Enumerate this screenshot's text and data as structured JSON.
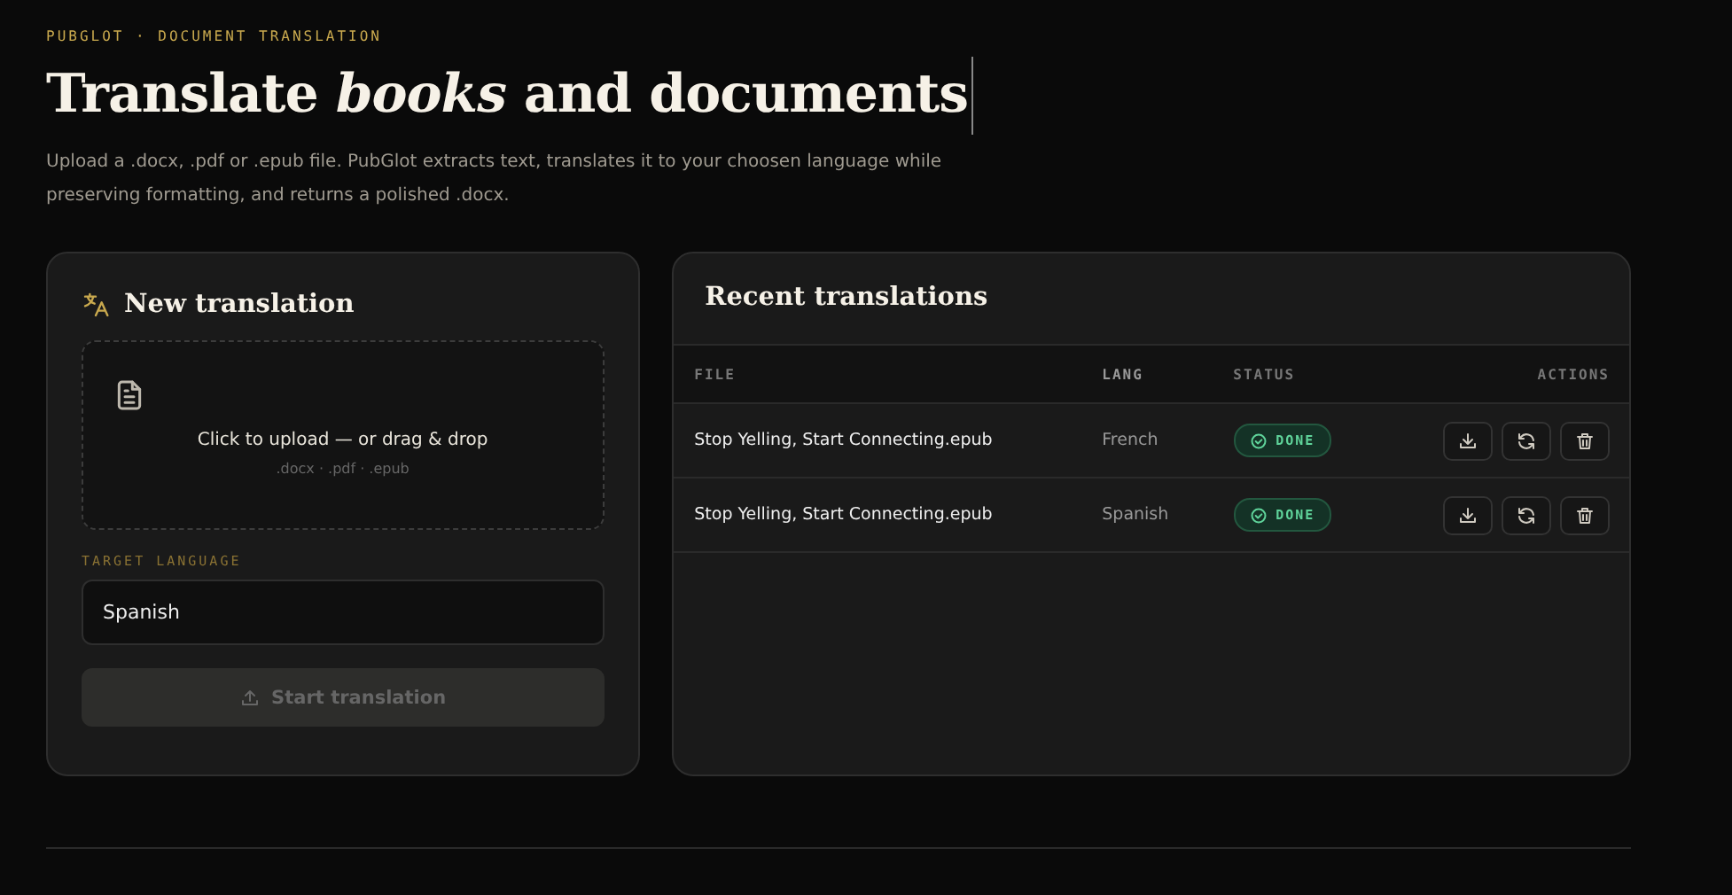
{
  "eyebrow": "PUBGLOT · DOCUMENT TRANSLATION",
  "headline": "Translate *books* and documents",
  "description": "Upload a .docx, .pdf or .epub file. PubGlot extracts text, translates it to your choosen language while preserving formatting, and returns a polished .docx.",
  "new_translation": {
    "title": "New translation",
    "upload": {
      "prompt": "Click to upload — or drag & drop",
      "formats": ".docx · .pdf · .epub"
    },
    "target_language": {
      "label": "TARGET LANGUAGE",
      "value": "Spanish"
    },
    "start_button": {
      "label": "Start translation",
      "disabled": true
    }
  },
  "recent": {
    "title": "Recent translations",
    "columns": [
      "FILE",
      "LANG",
      "STATUS",
      "ACTIONS"
    ],
    "rows": [
      {
        "file": "Stop Yelling, Start Connecting.epub",
        "lang": "French",
        "status": {
          "label": "DONE",
          "kind": "done"
        }
      },
      {
        "file": "Stop Yelling, Start Connecting.epub",
        "lang": "Spanish",
        "status": {
          "label": "DONE",
          "kind": "done"
        }
      }
    ]
  }
}
